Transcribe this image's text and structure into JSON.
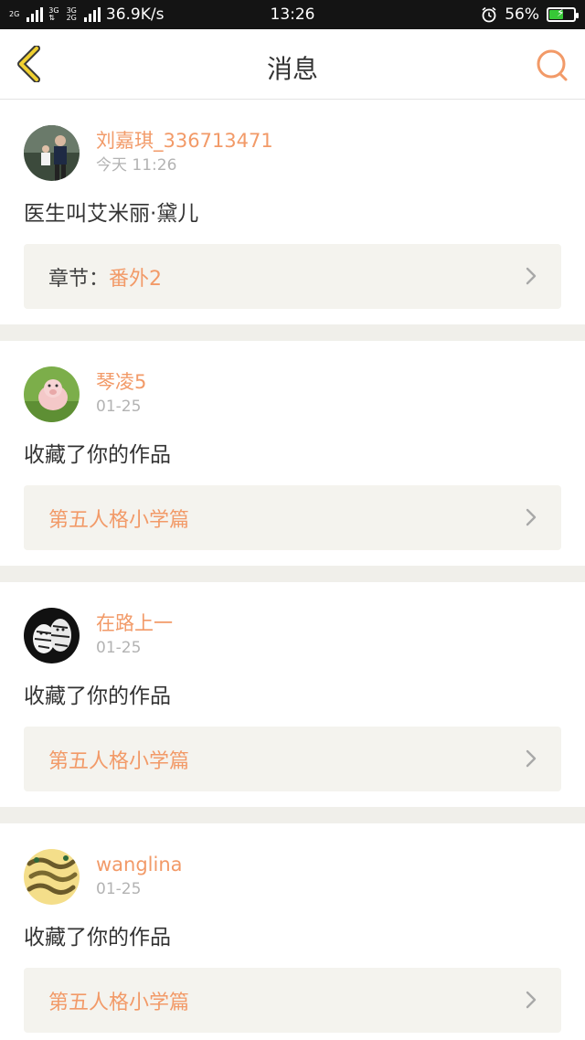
{
  "status_bar": {
    "net_top": "2G",
    "net_mid_a": "3G",
    "net_mid_b": "3G",
    "net_mid_c": "2G",
    "speed": "36.9K/s",
    "time": "13:26",
    "battery": "56%",
    "battery_level": 0.56
  },
  "nav": {
    "title": "消息",
    "back_icon": "chevron-left-icon",
    "search_icon": "search-icon"
  },
  "messages": [
    {
      "username": "刘嘉琪_336713471",
      "time": "今天 11:26",
      "text": "医生叫艾米丽·黛儿",
      "link_label": "章节：",
      "link_value": "番外2"
    },
    {
      "username": "琴凌5",
      "time": "01-25",
      "text": "收藏了你的作品",
      "link_label": "",
      "link_value": "第五人格小学篇"
    },
    {
      "username": "在路上一",
      "time": "01-25",
      "text": "收藏了你的作品",
      "link_label": "",
      "link_value": "第五人格小学篇"
    },
    {
      "username": "wanglina",
      "time": "01-25",
      "text": "收藏了你的作品",
      "link_label": "",
      "link_value": "第五人格小学篇"
    }
  ],
  "colors": {
    "accent": "#f29a68",
    "nav_back": "#f0d030",
    "background": "#f0efea"
  }
}
